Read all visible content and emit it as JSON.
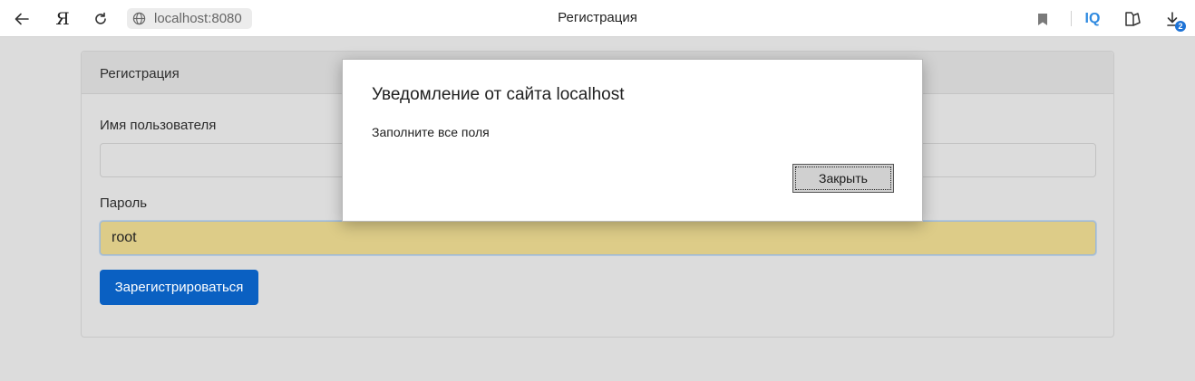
{
  "browser": {
    "url": "localhost:8080",
    "tab_title": "Регистрация",
    "yandex_label": "Я",
    "iq_label": "IQ",
    "downloads_count": "2",
    "icons": [
      "back-arrow-icon",
      "yandex-icon",
      "reload-icon",
      "globe-icon",
      "bookmark-icon",
      "iq-icon",
      "collections-icon",
      "downloads-icon"
    ]
  },
  "form": {
    "header": "Регистрация",
    "username_label": "Имя пользователя",
    "username_value": "",
    "password_label": "Пароль",
    "password_value": "root",
    "submit_label": "Зарегистрироваться"
  },
  "dialog": {
    "title": "Уведомление от сайта localhost",
    "message": "Заполните все поля",
    "close_label": "Закрыть"
  },
  "colors": {
    "primary_button": "#0a60c2",
    "autofill_bg": "#ddcc88",
    "page_overlay": "#dcdcdc",
    "iq_accent": "#2f8ae0"
  }
}
